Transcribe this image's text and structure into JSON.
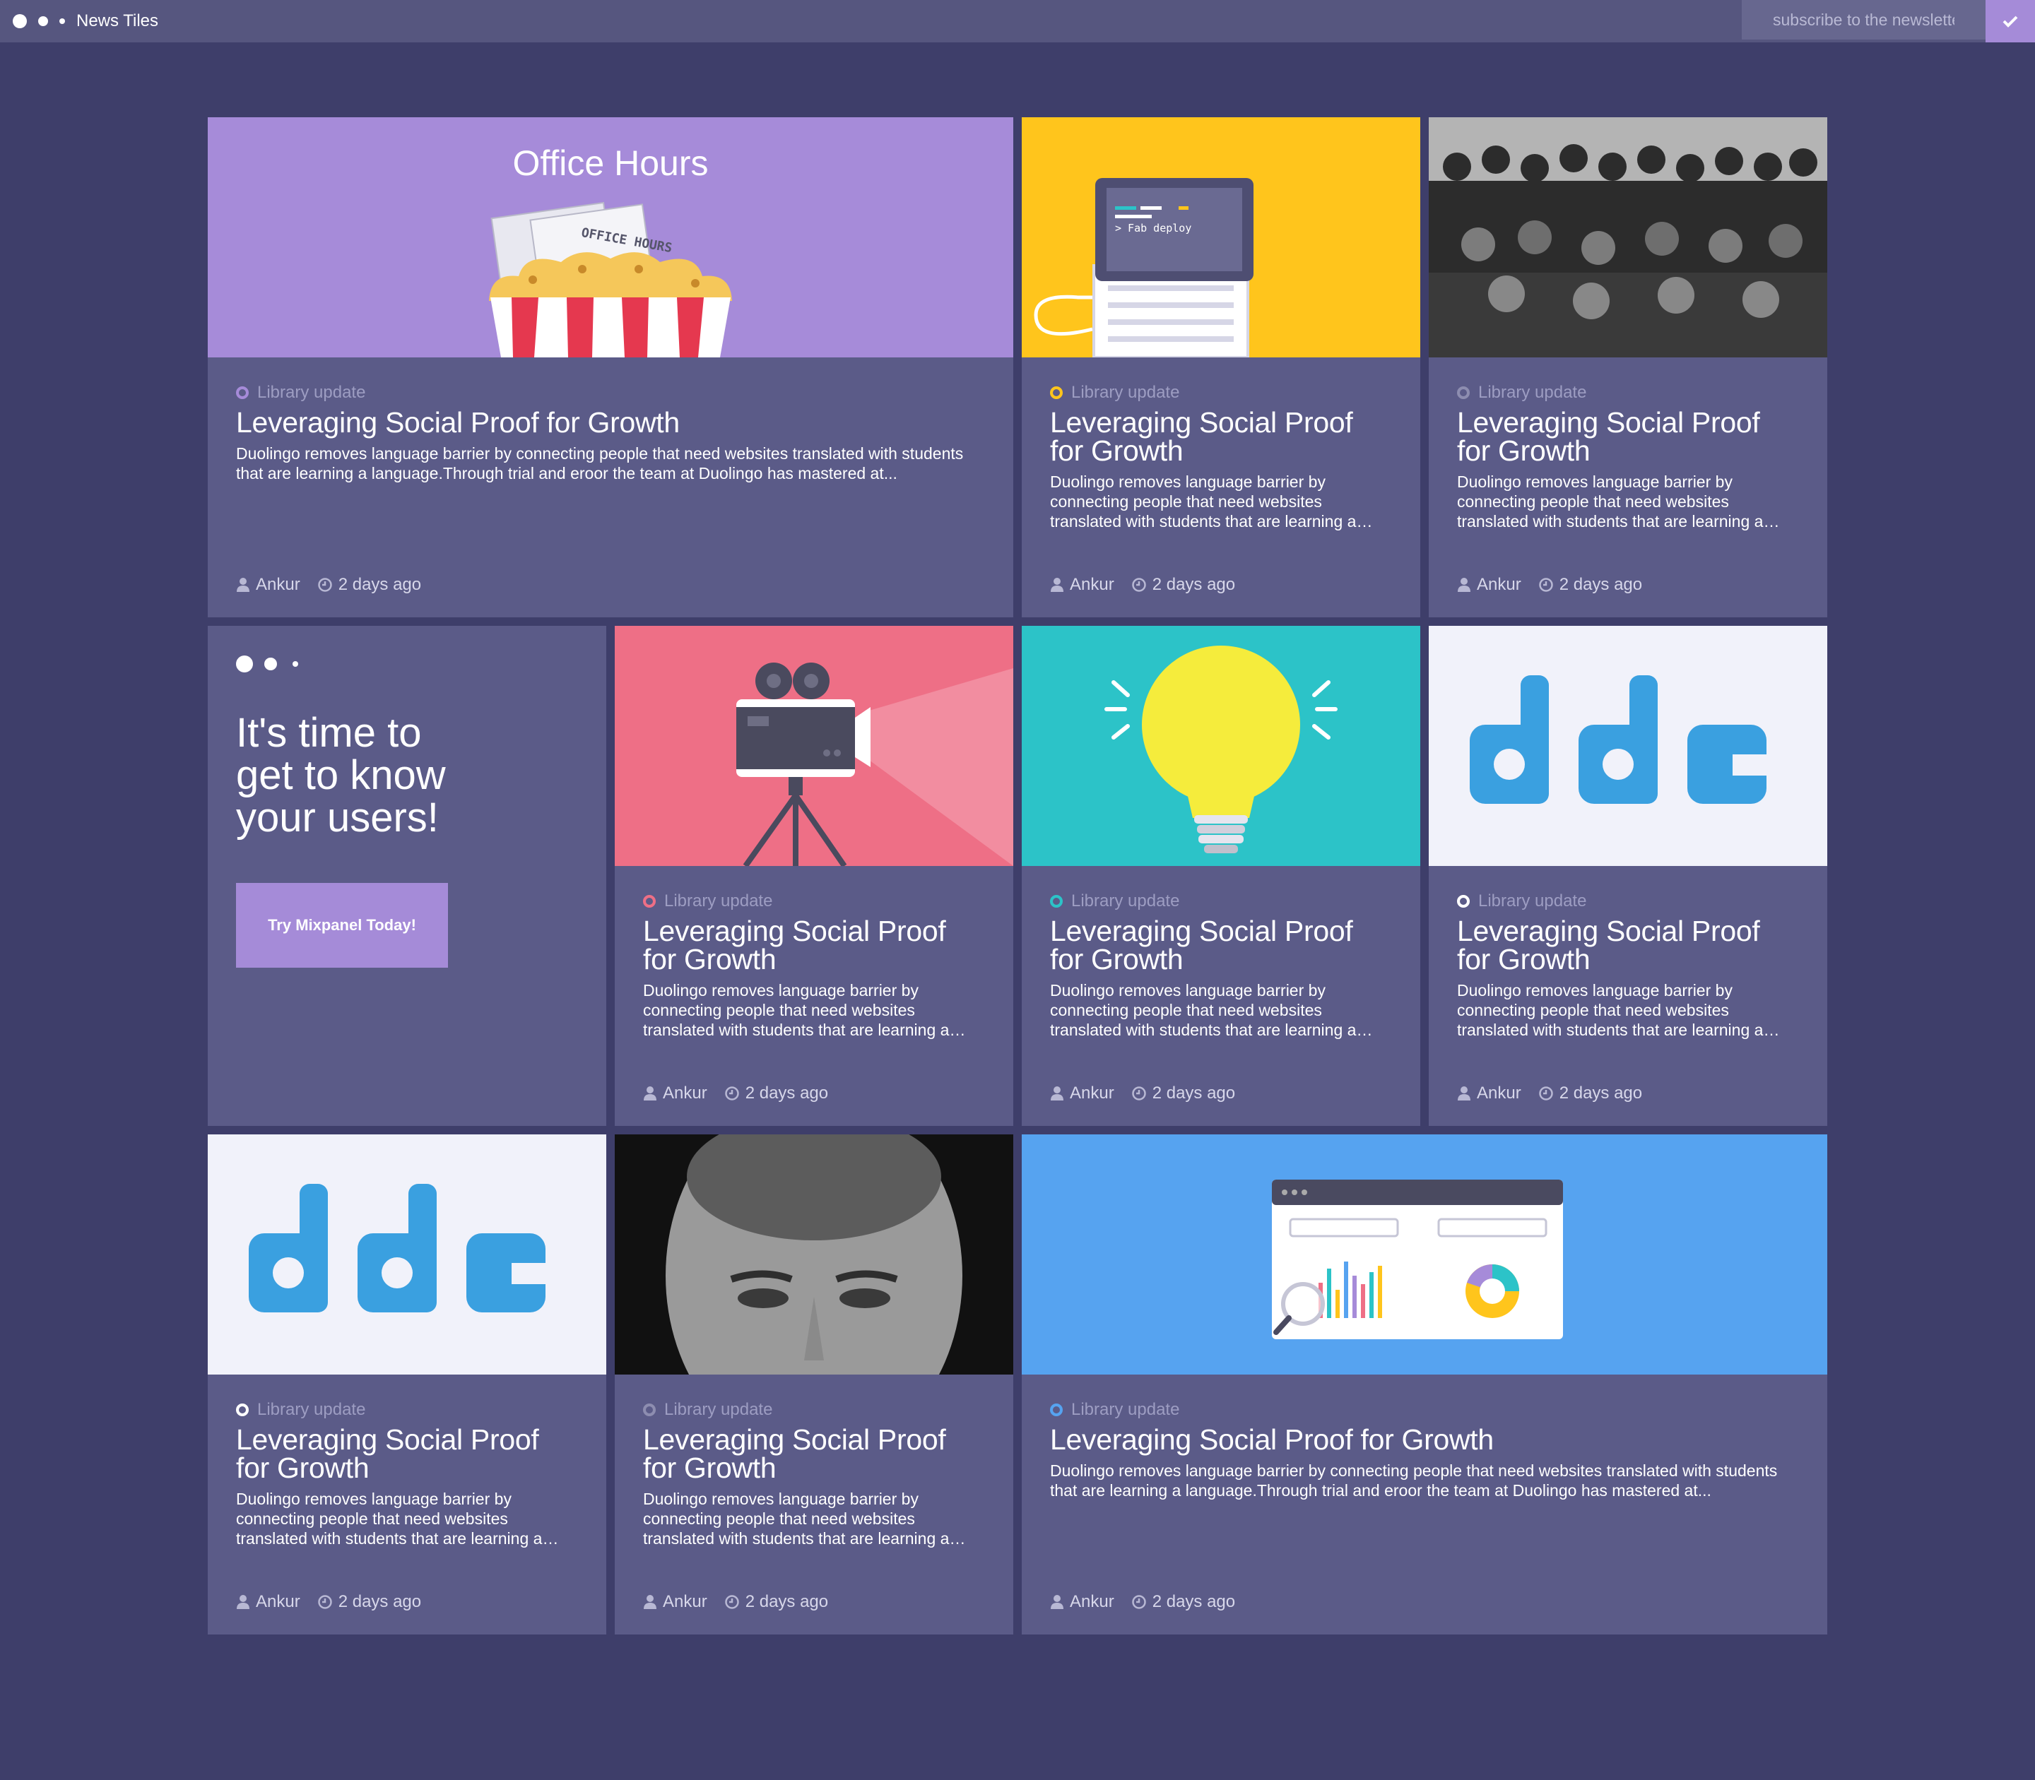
{
  "app": {
    "title": "News Tiles"
  },
  "newsletter": {
    "placeholder": "subscribe to the newsletter"
  },
  "promo": {
    "heading": "It's time to get to know your users!",
    "button_label": "Try Mixpanel Today!"
  },
  "colors": {
    "background": "#3e3e6a",
    "tile": "#5b5b88",
    "accent": "#a58bd8",
    "office_hours": "#a68bd9",
    "yellow": "#ffc51c",
    "pink": "#ee6f86",
    "teal": "#2cc3c8",
    "blue": "#56a3f0"
  },
  "tiles": [
    {
      "image": "office-hours-illustration",
      "image_text": "Office Hours",
      "ticket_text": "OFFICE HOURS",
      "ring_color": "#a68bd9",
      "category": "Library update",
      "title": "Leveraging Social Proof for Growth",
      "description": "Duolingo removes language barrier by connecting people that need websites translated with students that are learning a language.Through trial and eroor the team at Duolingo has mastered at...",
      "author": "Ankur",
      "time": "2 days ago"
    },
    {
      "image": "fab-deploy-laptop-illustration",
      "image_text": "> Fab deploy",
      "ring_color": "#ffc51c",
      "category": "Library update",
      "title": "Leveraging Social Proof for Growth",
      "description": "Duolingo removes language barrier by connecting people that need websites translated with students that are learning a language.",
      "author": "Ankur",
      "time": "2 days ago"
    },
    {
      "image": "team-group-photo",
      "ring_color": "#8d8db0",
      "category": "Library update",
      "title": "Leveraging Social Proof for Growth",
      "description": "Duolingo removes language barrier by connecting people that need websites translated with students that are learning a language.",
      "author": "Ankur",
      "time": "2 days ago"
    },
    {
      "image": "movie-camera-illustration",
      "ring_color": "#ee6f86",
      "category": "Library update",
      "title": "Leveraging Social Proof for Growth",
      "description": "Duolingo removes language barrier by connecting people that need websites translated with students that are learning a language.",
      "author": "Ankur",
      "time": "2 days ago"
    },
    {
      "image": "light-bulb-illustration",
      "ring_color": "#2cc3c8",
      "category": "Library update",
      "title": "Leveraging Social Proof for Growth",
      "description": "Duolingo removes language barrier by connecting people that need websites translated with students that are learning a language.",
      "author": "Ankur",
      "time": "2 days ago"
    },
    {
      "image": "ddc-logo",
      "ring_color": "#ffffff",
      "category": "Library update",
      "title": "Leveraging Social Proof for Growth",
      "description": "Duolingo removes language barrier by connecting people that need websites translated with students that are learning a language.",
      "author": "Ankur",
      "time": "2 days ago"
    },
    {
      "image": "ddc-logo",
      "ring_color": "#ffffff",
      "category": "Library update",
      "title": "Leveraging Social Proof for Growth",
      "description": "Duolingo removes language barrier by connecting people that need websites translated with students that are learning a language.",
      "author": "Ankur",
      "time": "2 days ago"
    },
    {
      "image": "man-portrait-photo",
      "ring_color": "#8d8db0",
      "category": "Library update",
      "title": "Leveraging Social Proof for Growth",
      "description": "Duolingo removes language barrier by connecting people that need websites translated with students that are learning a language.",
      "author": "Ankur",
      "time": "2 days ago"
    },
    {
      "image": "analytics-dashboard-illustration",
      "ring_color": "#56a3f0",
      "category": "Library update",
      "title": "Leveraging Social Proof for Growth",
      "description": "Duolingo removes language barrier by connecting people that need websites translated with students that are learning a language.Through trial and eroor the team at Duolingo has mastered at...",
      "author": "Ankur",
      "time": "2 days ago"
    }
  ]
}
